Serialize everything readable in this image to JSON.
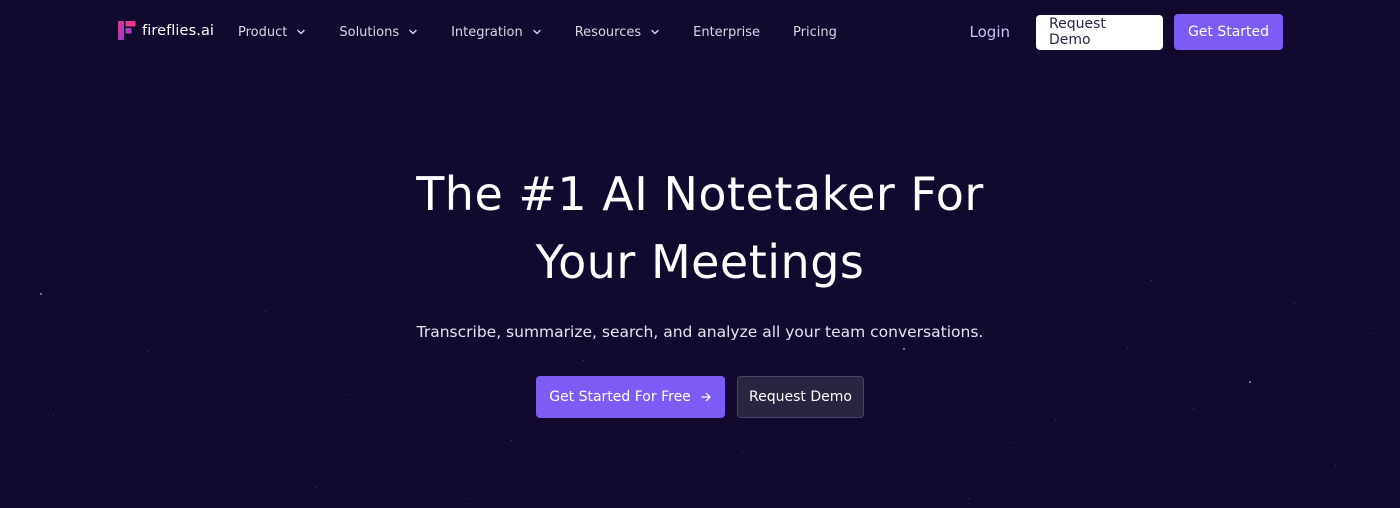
{
  "brand": {
    "name": "fireflies.ai",
    "logo_icon": "fireflies-logo-icon",
    "colors": {
      "background": "#110a2e",
      "accent": "#7c5cf5",
      "logo_pink": "#e9378a",
      "logo_purple": "#8a3bd6"
    }
  },
  "nav": {
    "menu": [
      {
        "label": "Product",
        "has_dropdown": true
      },
      {
        "label": "Solutions",
        "has_dropdown": true
      },
      {
        "label": "Integration",
        "has_dropdown": true
      },
      {
        "label": "Resources",
        "has_dropdown": true
      },
      {
        "label": "Enterprise",
        "has_dropdown": false
      },
      {
        "label": "Pricing",
        "has_dropdown": false
      }
    ],
    "login_label": "Login",
    "request_demo_label": "Request Demo",
    "get_started_label": "Get Started"
  },
  "hero": {
    "title_line1": "The #1 AI Notetaker For",
    "title_line2": "Your Meetings",
    "subtitle": "Transcribe, summarize, search, and analyze all your team conversations.",
    "primary_cta": "Get Started For Free",
    "primary_cta_icon": "arrow-right-icon",
    "secondary_cta": "Request Demo"
  }
}
